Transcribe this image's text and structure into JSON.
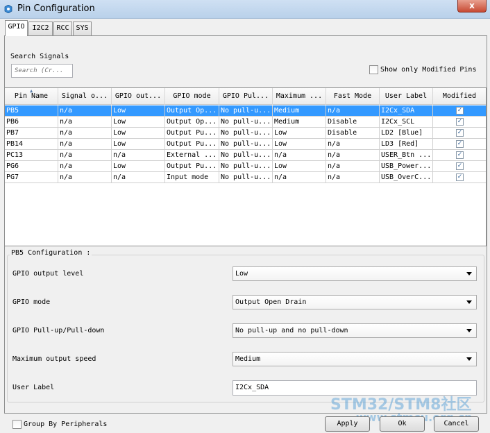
{
  "window": {
    "title": "Pin Configuration",
    "close_glyph": "x"
  },
  "tabs": [
    {
      "label": "GPIO",
      "active": true
    },
    {
      "label": "I2C2",
      "active": false
    },
    {
      "label": "RCC",
      "active": false
    },
    {
      "label": "SYS",
      "active": false
    }
  ],
  "search": {
    "label": "Search Signals",
    "placeholder": "Search (Cr..."
  },
  "show_modified": {
    "label": "Show only Modified Pins",
    "checked": false
  },
  "table": {
    "columns": [
      "Pin Name",
      "Signal o...",
      "GPIO out...",
      "GPIO mode",
      "GPIO Pul...",
      "Maximum ...",
      "Fast Mode",
      "User Label",
      "Modified"
    ],
    "rows": [
      {
        "pin": "PB5",
        "signal": "n/a",
        "out": "Low",
        "mode": "Output Op...",
        "pull": "No pull-u...",
        "max": "Medium",
        "fast": "n/a",
        "label": "I2Cx_SDA",
        "modified": true,
        "selected": true
      },
      {
        "pin": "PB6",
        "signal": "n/a",
        "out": "Low",
        "mode": "Output Op...",
        "pull": "No pull-u...",
        "max": "Medium",
        "fast": "Disable",
        "label": "I2Cx_SCL",
        "modified": true,
        "selected": false
      },
      {
        "pin": "PB7",
        "signal": "n/a",
        "out": "Low",
        "mode": "Output Pu...",
        "pull": "No pull-u...",
        "max": "Low",
        "fast": "Disable",
        "label": "LD2 [Blue]",
        "modified": true,
        "selected": false
      },
      {
        "pin": "PB14",
        "signal": "n/a",
        "out": "Low",
        "mode": "Output Pu...",
        "pull": "No pull-u...",
        "max": "Low",
        "fast": "n/a",
        "label": "LD3 [Red]",
        "modified": true,
        "selected": false
      },
      {
        "pin": "PC13",
        "signal": "n/a",
        "out": "n/a",
        "mode": "External ...",
        "pull": "No pull-u...",
        "max": "n/a",
        "fast": "n/a",
        "label": "USER_Btn ...",
        "modified": true,
        "selected": false
      },
      {
        "pin": "PG6",
        "signal": "n/a",
        "out": "Low",
        "mode": "Output Pu...",
        "pull": "No pull-u...",
        "max": "Low",
        "fast": "n/a",
        "label": "USB_Power...",
        "modified": true,
        "selected": false
      },
      {
        "pin": "PG7",
        "signal": "n/a",
        "out": "n/a",
        "mode": "Input mode",
        "pull": "No pull-u...",
        "max": "n/a",
        "fast": "n/a",
        "label": "USB_OverC...",
        "modified": true,
        "selected": false
      }
    ]
  },
  "config": {
    "title": "PB5 Configuration :",
    "fields": [
      {
        "label": "GPIO output level",
        "value": "Low",
        "type": "combo"
      },
      {
        "label": "GPIO mode",
        "value": "Output Open Drain",
        "type": "combo"
      },
      {
        "label": "GPIO Pull-up/Pull-down",
        "value": "No pull-up and no pull-down",
        "type": "combo"
      },
      {
        "label": "Maximum output speed",
        "value": "Medium",
        "type": "combo"
      },
      {
        "label": "User Label",
        "value": "I2Cx_SDA",
        "type": "text"
      }
    ]
  },
  "group_by": {
    "label": "Group By Peripherals",
    "checked": false
  },
  "buttons": {
    "apply": "Apply",
    "ok": "Ok",
    "cancel": "Cancel"
  },
  "watermark": {
    "line1": "STM32/STM8社区",
    "line2": "www.stmcu.org.cn"
  },
  "colors": {
    "selection": "#3399ff",
    "titlebar": "#b9d1ea",
    "close": "#c74a33"
  },
  "icons": {
    "app": "pin-config-app-icon",
    "sort": "sort-ascending-icon",
    "dropdown": "chevron-down-icon",
    "check": "checkmark-icon"
  }
}
